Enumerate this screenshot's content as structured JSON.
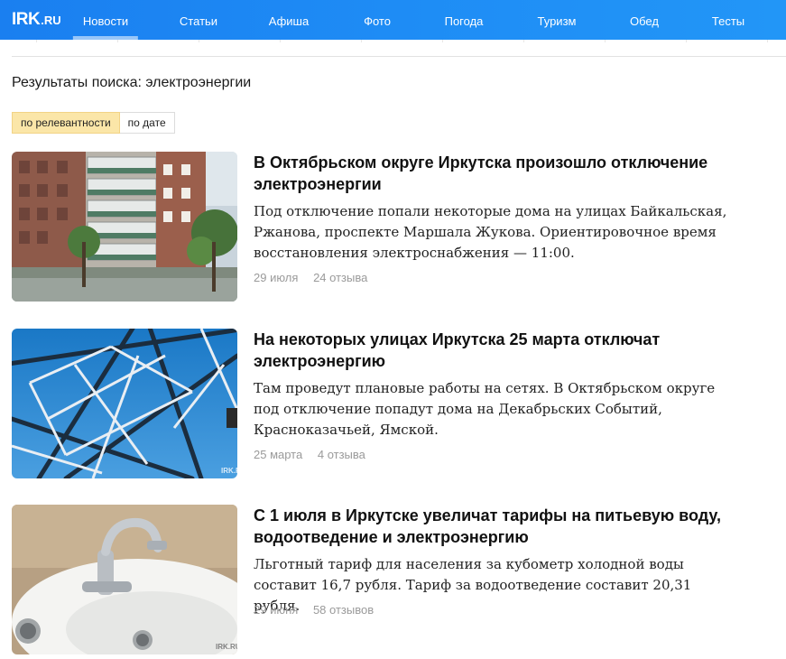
{
  "site": {
    "logo_main": "IRK",
    "logo_suffix": ".RU",
    "accent_color": "#1e8cf5"
  },
  "nav": {
    "items": [
      {
        "label": "Новости",
        "active": true
      },
      {
        "label": "Статьи",
        "active": false
      },
      {
        "label": "Афиша",
        "active": false
      },
      {
        "label": "Фото",
        "active": false
      },
      {
        "label": "Погода",
        "active": false
      },
      {
        "label": "Туризм",
        "active": false
      },
      {
        "label": "Обед",
        "active": false
      },
      {
        "label": "Тесты",
        "active": false
      }
    ]
  },
  "search": {
    "heading": "Результаты поиска: электроэнергии",
    "sort": {
      "relevance_label": "по релевантности",
      "date_label": "по дате",
      "selected": "по релевантности"
    }
  },
  "articles": [
    {
      "title": "В Октябрьском округе Иркутска произошло отключение электроэнергии",
      "text": "Под отключение попали некоторые дома на улицах Байкальская, Ржанова, проспекте Маршала Жукова. Ориентировочное время восстановления электроснабжения — 11:00.",
      "date": "29 июля",
      "comments": "24 отзыва",
      "image_icon": "apartment-building-image"
    },
    {
      "title": "На некоторых улицах Иркутска 25 марта отключат электроэнергию",
      "text": "Там проведут плановые работы на сетях. В Октябрьском округе под отключение попадут дома на Декабрьских Событий, Красноказачьей, Ямской.",
      "date": "25 марта",
      "comments": "4 отзыва",
      "image_icon": "power-tower-image",
      "watermark": "IRK.RU"
    },
    {
      "title": "С 1 июля в Иркутске увеличат тарифы на питьевую воду, водоотведение и электроэнергию",
      "text": "Льготный тариф для населения за кубометр холодной воды составит 16,7 рубля. Тариф за водоотведение составит 20,31 рубля.",
      "date": "29 июня",
      "comments": "58 отзывов",
      "image_icon": "sink-faucet-image",
      "watermark": "IRK.RU"
    }
  ]
}
